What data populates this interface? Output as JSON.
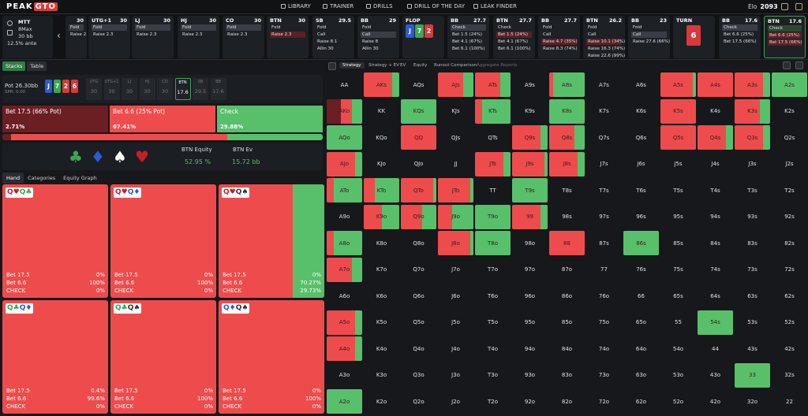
{
  "nav": {
    "logo_a": "PEAK",
    "logo_b": "GTO",
    "items": [
      "LIBRARY",
      "TRAINER",
      "DRILLS",
      "DRILL OF THE DAY",
      "LEAK FINDER"
    ],
    "elo_label": "Elo",
    "elo_value": "2093"
  },
  "game": {
    "type": "MTT",
    "max": "8Max",
    "depth": "30 bb",
    "ante": "12.5% ante"
  },
  "strip": [
    {
      "pos": "",
      "stack": "30",
      "actions": [
        {
          "t": "Fold",
          "s": "sel"
        },
        {
          "t": "Raise 2.3",
          "s": ""
        }
      ]
    },
    {
      "pos": "UTG+1",
      "stack": "30",
      "actions": [
        {
          "t": "Fold",
          "s": "sel"
        },
        {
          "t": "Raise 2.3",
          "s": ""
        }
      ]
    },
    {
      "pos": "LJ",
      "stack": "30",
      "actions": [
        {
          "t": "Fold",
          "s": "sel"
        },
        {
          "t": "Raise 2.3",
          "s": ""
        }
      ]
    },
    {
      "pos": "HJ",
      "stack": "30",
      "actions": [
        {
          "t": "Fold",
          "s": "sel"
        },
        {
          "t": "Raise 2.3",
          "s": ""
        }
      ]
    },
    {
      "pos": "CO",
      "stack": "30",
      "actions": [
        {
          "t": "Fold",
          "s": "sel"
        },
        {
          "t": "Raise 2.3",
          "s": ""
        }
      ]
    },
    {
      "pos": "BTN",
      "stack": "30",
      "actions": [
        {
          "t": "Fold",
          "s": ""
        },
        {
          "t": "Raise 2.3",
          "s": "red"
        }
      ]
    },
    {
      "pos": "SB",
      "stack": "29.5",
      "actions": [
        {
          "t": "Fold",
          "s": ""
        },
        {
          "t": "Call",
          "s": ""
        },
        {
          "t": "Raise 8.1",
          "s": ""
        },
        {
          "t": "Allin 30",
          "s": ""
        }
      ]
    },
    {
      "pos": "BB",
      "stack": "29",
      "actions": [
        {
          "t": "Fold",
          "s": ""
        },
        {
          "t": "Call",
          "s": "sel"
        },
        {
          "t": "Raise 8",
          "s": ""
        },
        {
          "t": "Allin 30",
          "s": ""
        }
      ]
    },
    {
      "pos": "FLOP",
      "stack": "",
      "actions": []
    },
    {
      "pos": "BB",
      "stack": "27.7",
      "actions": [
        {
          "t": "Check",
          "s": "sel"
        },
        {
          "t": "Bet 1.5 (24%)",
          "s": ""
        },
        {
          "t": "Bet 4.1 (67%)",
          "s": ""
        },
        {
          "t": "Bet 6.1 (100%)",
          "s": ""
        }
      ]
    },
    {
      "pos": "BTN",
      "stack": "27.7",
      "actions": [
        {
          "t": "Check",
          "s": ""
        },
        {
          "t": "Bet 1.5 (24%)",
          "s": "red"
        },
        {
          "t": "Bet 4.1 (67%)",
          "s": ""
        },
        {
          "t": "Bet 6.1 (100%)",
          "s": ""
        }
      ]
    },
    {
      "pos": "BB",
      "stack": "27.7",
      "actions": [
        {
          "t": "Fold",
          "s": ""
        },
        {
          "t": "Call",
          "s": ""
        },
        {
          "t": "Raise 4.7 (35%)",
          "s": "red"
        },
        {
          "t": "Raise 8.3 (74%)",
          "s": ""
        }
      ]
    },
    {
      "pos": "BTN",
      "stack": "26.2",
      "actions": [
        {
          "t": "Fold",
          "s": ""
        },
        {
          "t": "Call",
          "s": ""
        },
        {
          "t": "Raise 10.1 (34%)",
          "s": "red"
        },
        {
          "t": "Raise 16.3 (74%)",
          "s": ""
        },
        {
          "t": "Raise 22.6 (99%)",
          "s": ""
        }
      ]
    },
    {
      "pos": "BB",
      "stack": "23",
      "actions": [
        {
          "t": "Fold",
          "s": ""
        },
        {
          "t": "Call",
          "s": "sel"
        },
        {
          "t": "Raise 27.6 (66%)",
          "s": ""
        }
      ]
    },
    {
      "pos": "TURN",
      "stack": "",
      "actions": []
    },
    {
      "pos": "BB",
      "stack": "17.6",
      "actions": [
        {
          "t": "Check",
          "s": "sel"
        },
        {
          "t": "Bet 6.6 (25%)",
          "s": ""
        },
        {
          "t": "Bet 17.5 (66%)",
          "s": ""
        }
      ]
    },
    {
      "pos": "BTN",
      "stack": "17.6",
      "actions": [
        {
          "t": "Check",
          "s": "grn"
        },
        {
          "t": "Bet 6.6 (25%)",
          "s": "red"
        },
        {
          "t": "Bet 17.5 (66%)",
          "s": "red"
        }
      ]
    }
  ],
  "flop_cards": [
    {
      "r": "J",
      "c": "#2a5bd7"
    },
    {
      "r": "7",
      "c": "#3aa655"
    },
    {
      "r": "2",
      "c": "#d63a3a"
    }
  ],
  "turn_card": "6",
  "left_tabs": [
    "Stacks",
    "Table"
  ],
  "pot": {
    "label": "Pot",
    "value": "26.30bb",
    "spr": "SPR: 0.00"
  },
  "board_cards": [
    {
      "r": "J",
      "c": "#2a5bd7"
    },
    {
      "r": "7",
      "c": "#3aa655"
    },
    {
      "r": "2",
      "c": "#d63a3a"
    },
    {
      "r": "6",
      "c": "#d63a3a"
    }
  ],
  "seats": [
    {
      "n": "UTG",
      "v": "30",
      "on": false
    },
    {
      "n": "UTG+1",
      "v": "30",
      "on": false
    },
    {
      "n": "LJ",
      "v": "30",
      "on": false
    },
    {
      "n": "HJ",
      "v": "30",
      "on": false
    },
    {
      "n": "CO",
      "v": "30",
      "on": false
    },
    {
      "n": "BTN",
      "v": "17.6",
      "on": true
    },
    {
      "n": "SB",
      "v": "29.5",
      "on": false
    },
    {
      "n": "BB",
      "v": "17.6",
      "on": false
    }
  ],
  "actions": [
    {
      "label": "Bet 17.5 (66% Pot)",
      "pct": "2.71%",
      "color": "#6b1f22",
      "w": 134
    },
    {
      "label": "Bet 6.6 (25% Pot)",
      "pct": "67.41%",
      "color": "#ee4c4c",
      "w": 134
    },
    {
      "label": "Check",
      "pct": "29.88%",
      "color": "#58c06a",
      "w": 134
    }
  ],
  "pbar": [
    {
      "f": 0.0271,
      "c": "#6b1f22"
    },
    {
      "f": 0.6741,
      "c": "#ee4c4c"
    },
    {
      "f": 0.2988,
      "c": "#58c06a"
    }
  ],
  "equity": {
    "eq_label": "BTN Equity",
    "eq_value": "52.95 %",
    "ev_label": "BTN Ev",
    "ev_value": "15.72 bb"
  },
  "suits": [
    {
      "s": "♣",
      "c": "#3aa655"
    },
    {
      "s": "♦",
      "c": "#2a5bd7"
    },
    {
      "s": "♠",
      "c": "#ffffff"
    },
    {
      "s": "♥",
      "c": "#c81e28"
    }
  ],
  "hand_tabs": [
    "Hand",
    "Categories",
    "Equity Graph"
  ],
  "combos": [
    {
      "c": [
        [
          "Q",
          "♥",
          "#c81e28"
        ],
        [
          "Q",
          "♣",
          "#3aa655"
        ]
      ],
      "v": [
        "0%",
        "100%",
        "0%"
      ],
      "check": 0
    },
    {
      "c": [
        [
          "Q",
          "♥",
          "#c81e28"
        ],
        [
          "Q",
          "♦",
          "#2a5bd7"
        ]
      ],
      "v": [
        "0%",
        "100%",
        "0%"
      ],
      "check": 0
    },
    {
      "c": [
        [
          "Q",
          "♥",
          "#c81e28"
        ],
        [
          "Q",
          "♠",
          "#333333"
        ]
      ],
      "v": [
        "0%",
        "70.27%",
        "29.73%"
      ],
      "check": 0.2973
    },
    {
      "c": [
        [
          "Q",
          "♣",
          "#3aa655"
        ],
        [
          "Q",
          "♦",
          "#2a5bd7"
        ]
      ],
      "v": [
        "0.4%",
        "99.6%",
        "0%"
      ],
      "check": 0
    },
    {
      "c": [
        [
          "Q",
          "♣",
          "#3aa655"
        ],
        [
          "Q",
          "♠",
          "#333333"
        ]
      ],
      "v": [
        "0%",
        "100%",
        "0%"
      ],
      "check": 0
    },
    {
      "c": [
        [
          "Q",
          "♦",
          "#2a5bd7"
        ],
        [
          "Q",
          "♠",
          "#333333"
        ]
      ],
      "v": [
        "0%",
        "100%",
        "0%"
      ],
      "check": 0
    }
  ],
  "row_labels": [
    "Bet 17.5",
    "Bet 6.6",
    "CHECK"
  ],
  "right_tabs": [
    "Strategy",
    "Strategy + EV",
    "EV",
    "Equity",
    "Runout Comparison",
    "Aggregate Reports"
  ],
  "ranks": [
    "A",
    "K",
    "Q",
    "J",
    "T",
    "9",
    "8",
    "7",
    "6",
    "5",
    "4",
    "3",
    "2"
  ],
  "grid_cells": {
    "AKs": [
      0,
      0.8,
      0.2
    ],
    "AJs": [
      0,
      0.7,
      0.3
    ],
    "ATs": [
      0,
      0.7,
      0.3
    ],
    "A8s": [
      0,
      0.1,
      0.9
    ],
    "A5s": [
      0,
      0.9,
      0.1
    ],
    "A4s": [
      0,
      1,
      0
    ],
    "A3s": [
      0,
      0.8,
      0.2
    ],
    "A2s": [
      0,
      0,
      1
    ],
    "AKo": [
      0.4,
      0.3,
      0.3
    ],
    "KQs": [
      0,
      0,
      1
    ],
    "KTs": [
      0,
      0.2,
      0.8
    ],
    "K8s": [
      0,
      0,
      1
    ],
    "K5s": [
      0,
      1,
      0
    ],
    "K3s": [
      0,
      0.7,
      0.3
    ],
    "AQo": [
      0,
      0,
      1
    ],
    "QQ": [
      0,
      1,
      0
    ],
    "Q9s": [
      0,
      0.8,
      0.2
    ],
    "Q8s": [
      0,
      0.7,
      0.3
    ],
    "Q5s": [
      0,
      1,
      0
    ],
    "Q4s": [
      0,
      0.8,
      0.2
    ],
    "Q3s": [
      0,
      0.8,
      0.2
    ],
    "AJo": [
      0,
      0.8,
      0.2
    ],
    "JTs": [
      0,
      0.8,
      0.2
    ],
    "J9s": [
      0,
      0.9,
      0.1
    ],
    "J8s": [
      0,
      0.8,
      0.2
    ],
    "ATo": [
      0,
      0.2,
      0.8
    ],
    "KTo": [
      0,
      0.3,
      0.7
    ],
    "QTo": [
      0,
      0.9,
      0.1
    ],
    "JTo": [
      0,
      0.9,
      0.1
    ],
    "T9s": [
      0,
      0,
      1
    ],
    "K9o": [
      0,
      0.5,
      0.5
    ],
    "Q9o": [
      0,
      0.6,
      0.4
    ],
    "J9o": [
      0,
      0.4,
      0.6
    ],
    "T9o": [
      0,
      0,
      1
    ],
    "99": [
      0,
      0.8,
      0.2
    ],
    "A8o": [
      0,
      0.2,
      0.8
    ],
    "J8o": [
      0,
      0.9,
      0.1
    ],
    "T8o": [
      0,
      0,
      1
    ],
    "88": [
      0,
      1,
      0
    ],
    "86s": [
      0,
      0,
      1
    ],
    "A7o": [
      0,
      0.7,
      0.3
    ],
    "A5o": [
      0,
      0.8,
      0.2
    ],
    "54s": [
      0,
      0,
      1
    ],
    "A4o": [
      0,
      0.8,
      0.2
    ],
    "33": [
      0,
      0,
      1
    ],
    "A2o": [
      0,
      0,
      1
    ]
  }
}
